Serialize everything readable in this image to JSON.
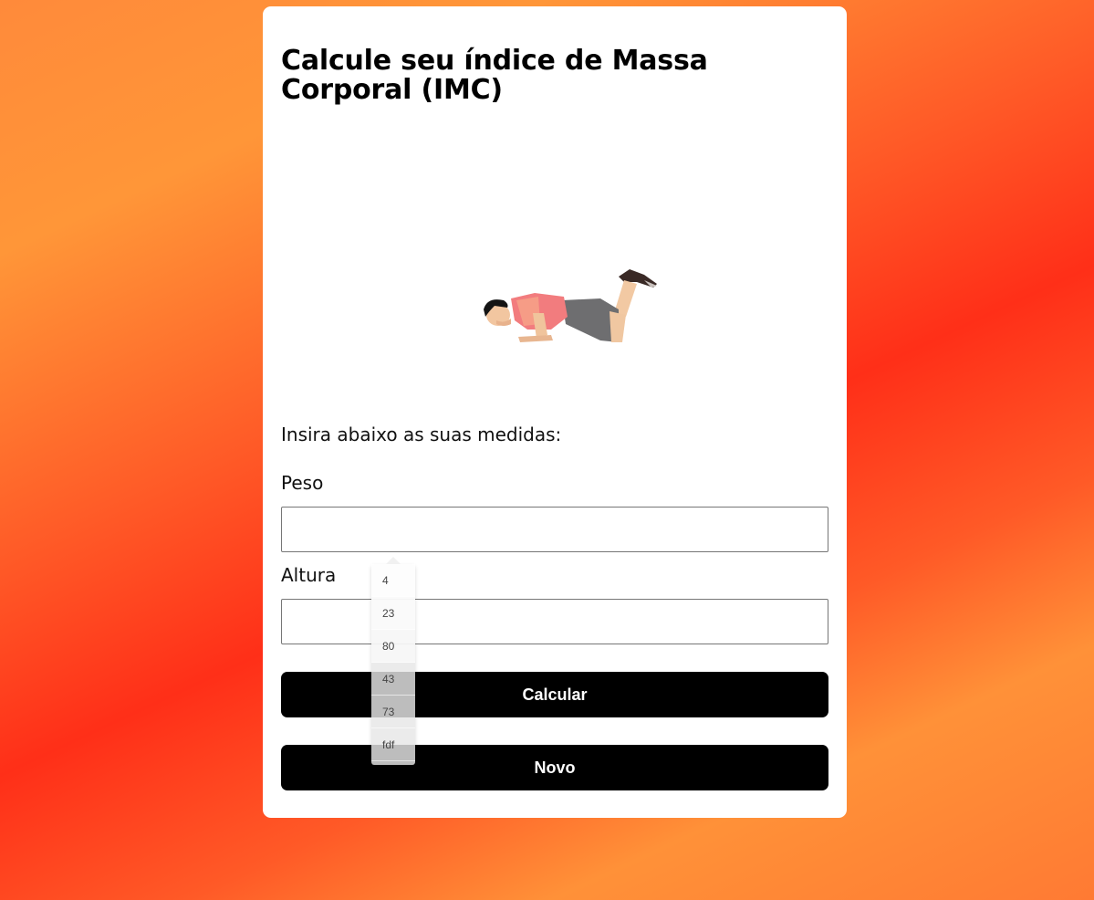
{
  "card": {
    "title": "Calcule seu índice de Massa Corporal (IMC)",
    "intro": "Insira abaixo as suas medidas:",
    "image_icon": "push-up-person-illustration"
  },
  "form": {
    "peso_label": "Peso",
    "peso_value": "",
    "altura_label": "Altura",
    "altura_value": "",
    "calcular_label": "Calcular",
    "novo_label": "Novo"
  },
  "autocomplete": {
    "items": [
      "4",
      "23",
      "80",
      "43",
      "73",
      "fdf"
    ]
  },
  "colors": {
    "background_light": "#ff9638",
    "background_dark": "#ff2f18",
    "card": "#ffffff",
    "button": "#000000",
    "button_text": "#ffffff"
  }
}
